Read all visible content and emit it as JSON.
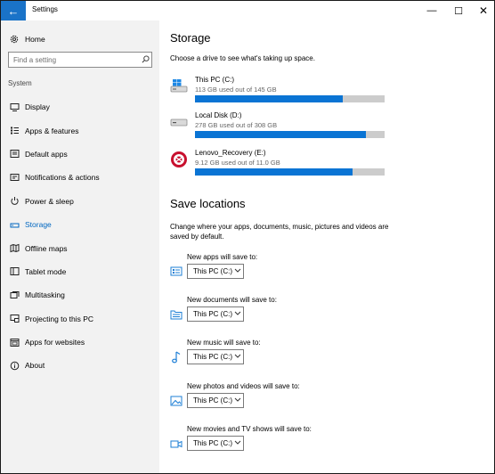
{
  "window": {
    "title": "Settings"
  },
  "titlebar": {
    "back_glyph": "←",
    "min_glyph": "—",
    "max_glyph": "☐",
    "close_glyph": "✕"
  },
  "sidebar": {
    "home_label": "Home",
    "search_placeholder": "Find a setting",
    "section": "System",
    "items": [
      {
        "label": "Display",
        "icon": "display-icon"
      },
      {
        "label": "Apps & features",
        "icon": "apps-features-icon"
      },
      {
        "label": "Default apps",
        "icon": "default-apps-icon"
      },
      {
        "label": "Notifications & actions",
        "icon": "notifications-icon"
      },
      {
        "label": "Power & sleep",
        "icon": "power-icon"
      },
      {
        "label": "Storage",
        "icon": "storage-icon",
        "active": true
      },
      {
        "label": "Offline maps",
        "icon": "offline-maps-icon"
      },
      {
        "label": "Tablet mode",
        "icon": "tablet-mode-icon"
      },
      {
        "label": "Multitasking",
        "icon": "multitasking-icon"
      },
      {
        "label": "Projecting to this PC",
        "icon": "projecting-icon"
      },
      {
        "label": "Apps for websites",
        "icon": "apps-websites-icon"
      },
      {
        "label": "About",
        "icon": "about-icon"
      }
    ]
  },
  "main": {
    "title": "Storage",
    "subtitle": "Choose a drive to see what's taking up space.",
    "drives": [
      {
        "name": "This PC (C:)",
        "usage": "113 GB used out of 145 GB",
        "used_fraction": 0.78,
        "icon": "windows-drive-icon"
      },
      {
        "name": "Local Disk (D:)",
        "usage": "278 GB used out of 308 GB",
        "used_fraction": 0.9,
        "icon": "local-disk-icon"
      },
      {
        "name": "Lenovo_Recovery (E:)",
        "usage": "9.12 GB used out of 11.0 GB",
        "used_fraction": 0.83,
        "icon": "recovery-drive-icon"
      }
    ],
    "save_locations": {
      "title": "Save locations",
      "description": "Change where your apps, documents, music, pictures and videos are saved by default.",
      "items": [
        {
          "label": "New apps will save to:",
          "value": "This PC (C:)",
          "icon": "apps-save-icon"
        },
        {
          "label": "New documents will save to:",
          "value": "This PC (C:)",
          "icon": "documents-icon"
        },
        {
          "label": "New music will save to:",
          "value": "This PC (C:)",
          "icon": "music-icon"
        },
        {
          "label": "New photos and videos will save to:",
          "value": "This PC (C:)",
          "icon": "photos-icon"
        },
        {
          "label": "New movies and TV shows will save to:",
          "value": "This PC (C:)",
          "icon": "movies-icon"
        }
      ]
    }
  },
  "colors": {
    "accent": "#0a74d4",
    "bar_track": "#cccccc",
    "sidebar_bg": "#f2f2f2"
  }
}
